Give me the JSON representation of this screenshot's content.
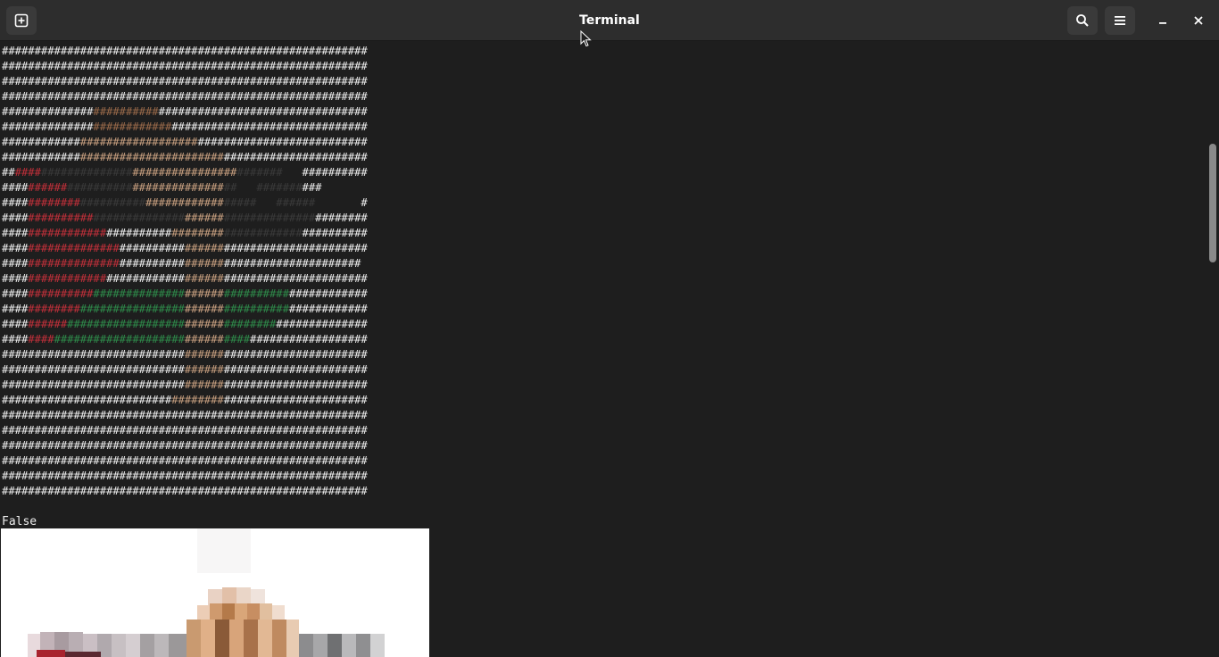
{
  "window": {
    "title": "Terminal"
  },
  "headerbar": {
    "new_tab_icon": "new-tab-icon",
    "search_icon": "search-icon",
    "menu_icon": "hamburger-menu-icon",
    "minimize_icon": "minimize-icon",
    "close_icon": "close-icon"
  },
  "terminal": {
    "art_rows": [
      "########################################################",
      "########################################################",
      "########################################################",
      "########################################################",
      "########################################################",
      "########################################################",
      "########################################################",
      "########################################################",
      "###########################################   ##########",
      "####################################   ##########       ",
      "#######################################   ######       #",
      "########################################################",
      "########################################################",
      "########################################################",
      "#######################################################",
      "########################################################",
      "########################################################",
      "########################################################",
      "########################################################",
      "########################################################",
      "########################################################",
      "########################################################",
      "########################################################",
      "########################################################",
      "########################################################",
      "########################################################",
      "########################################################",
      "########################################################",
      "########################################################",
      "########################################################"
    ],
    "output_text": "False"
  },
  "colors": {
    "background": "#1e1e1e",
    "headerbar": "#2d2d2d",
    "text": "#eeeeee",
    "red": "#c0303a",
    "green": "#2e8a4a",
    "tan": "#c8a080",
    "brown": "#9a6a4a",
    "dark": "#3a3a3a"
  }
}
